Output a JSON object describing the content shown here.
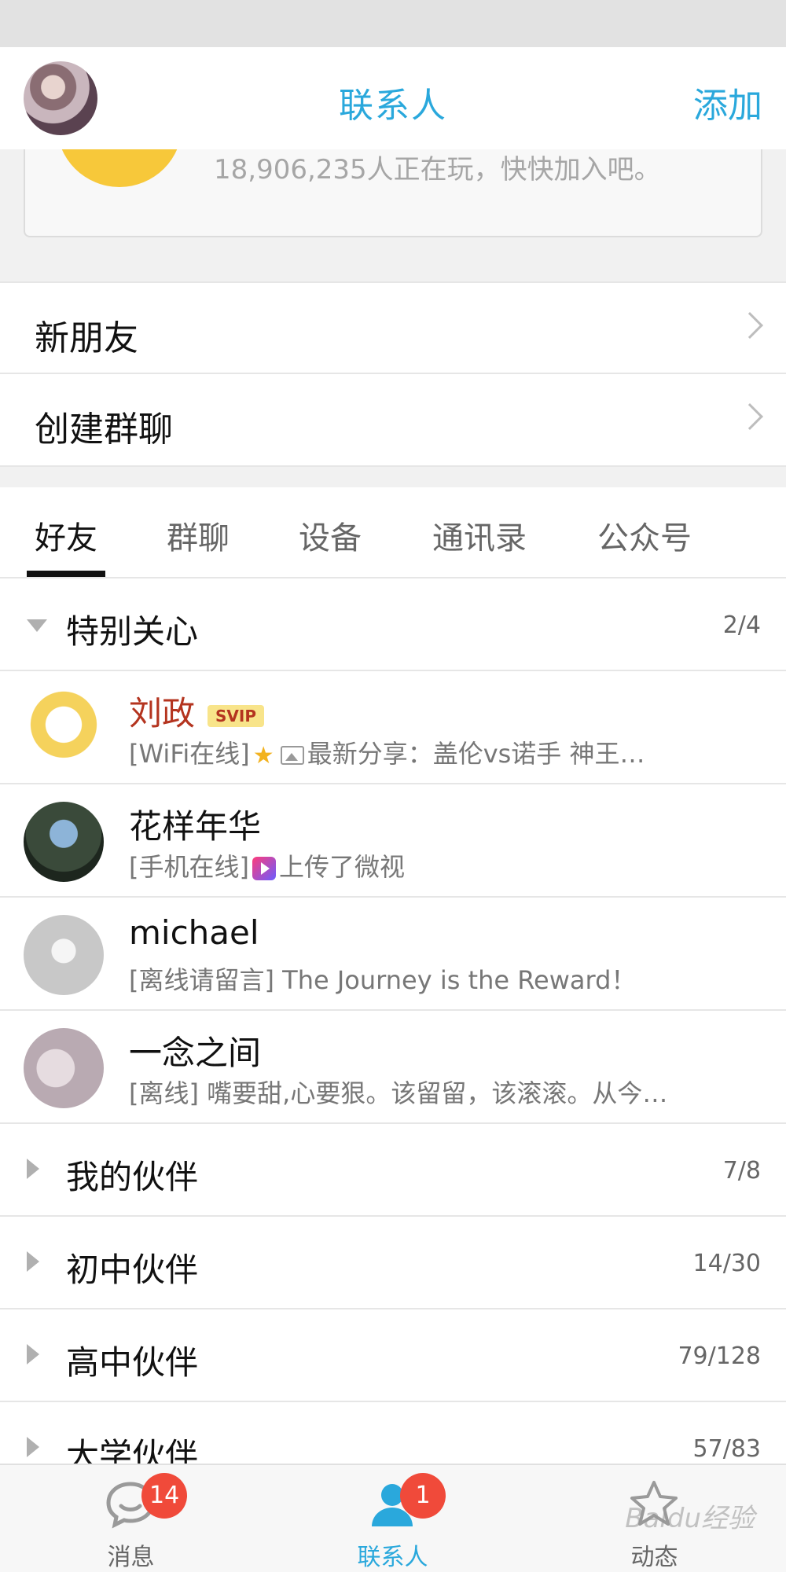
{
  "header": {
    "title": "联系人",
    "add_label": "添加"
  },
  "promo": {
    "text": "18,906,235人正在玩，快快加入吧。"
  },
  "menu": [
    {
      "label": "新朋友"
    },
    {
      "label": "创建群聊"
    }
  ],
  "tabs": [
    {
      "label": "好友"
    },
    {
      "label": "群聊"
    },
    {
      "label": "设备"
    },
    {
      "label": "通讯录"
    },
    {
      "label": "公众号"
    }
  ],
  "special": {
    "name": "特别关心",
    "count": "2/4",
    "contacts": [
      {
        "name": "刘政",
        "badge": "SVIP",
        "status_prefix": "[WiFi在线]",
        "status": "最新分享：盖伦vs诺手 神王…",
        "name_color": "#b4341f"
      },
      {
        "name": "花样年华",
        "status_prefix": "[手机在线]",
        "status": "上传了微视"
      },
      {
        "name": "michael",
        "status_prefix": "[离线请留言]",
        "status": "The Journey is the Reward！"
      },
      {
        "name": "一念之间",
        "status_prefix": "[离线]",
        "status": "嘴要甜,心要狠。该留留，该滚滚。从今…"
      }
    ]
  },
  "groups": [
    {
      "name": "我的伙伴",
      "count": "7/8"
    },
    {
      "name": "初中伙伴",
      "count": "14/30"
    },
    {
      "name": "高中伙伴",
      "count": "79/128"
    },
    {
      "name": "大学伙伴",
      "count": "57/83"
    }
  ],
  "tabbar": {
    "items": [
      {
        "label": "消息",
        "badge": "14"
      },
      {
        "label": "联系人",
        "badge": "1"
      },
      {
        "label": "动态"
      }
    ]
  },
  "watermark": "Baidu经验",
  "colors": {
    "accent": "#2aa8dc",
    "badge": "#f04a3a",
    "vip_name": "#b4341f"
  }
}
